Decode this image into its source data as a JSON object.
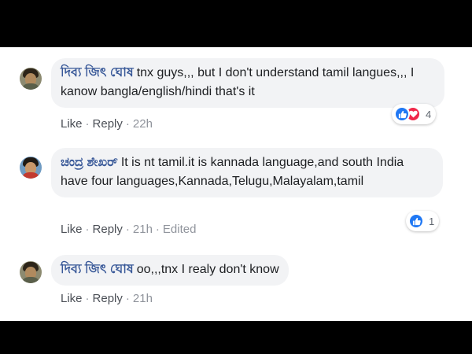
{
  "comments": [
    {
      "author": "দিব্য জিৎ ঘোষ",
      "text": "tnx guys,,, but I don't understand tamil langues,,, I kanow bangla/english/hindi that's it",
      "like_label": "Like",
      "reply_label": "Reply",
      "time": "22h",
      "edited": "",
      "reactions": [
        "like",
        "love"
      ],
      "reaction_count": "4"
    },
    {
      "author": "ಚಂದ್ರ ಶೇಖರ್",
      "text": "It is nt tamil.it is kannada language,and south India have four languages,Kannada,Telugu,Malayalam,tamil",
      "like_label": "Like",
      "reply_label": "Reply",
      "time": "21h",
      "edited": "Edited",
      "reactions": [
        "like"
      ],
      "reaction_count": "1"
    },
    {
      "author": "দিব্য জিৎ ঘোষ",
      "text": "oo,,,tnx I realy don't know",
      "like_label": "Like",
      "reply_label": "Reply",
      "time": "21h",
      "edited": "",
      "reactions": [],
      "reaction_count": ""
    }
  ],
  "colors": {
    "author": "#385898",
    "bubble": "#f2f3f5",
    "like_reaction": "#2078f4",
    "love_reaction": "#f0284a",
    "meta_text": "#90949c"
  },
  "icons": {
    "like_reaction": "thumbs-up-icon",
    "love_reaction": "heart-icon"
  }
}
